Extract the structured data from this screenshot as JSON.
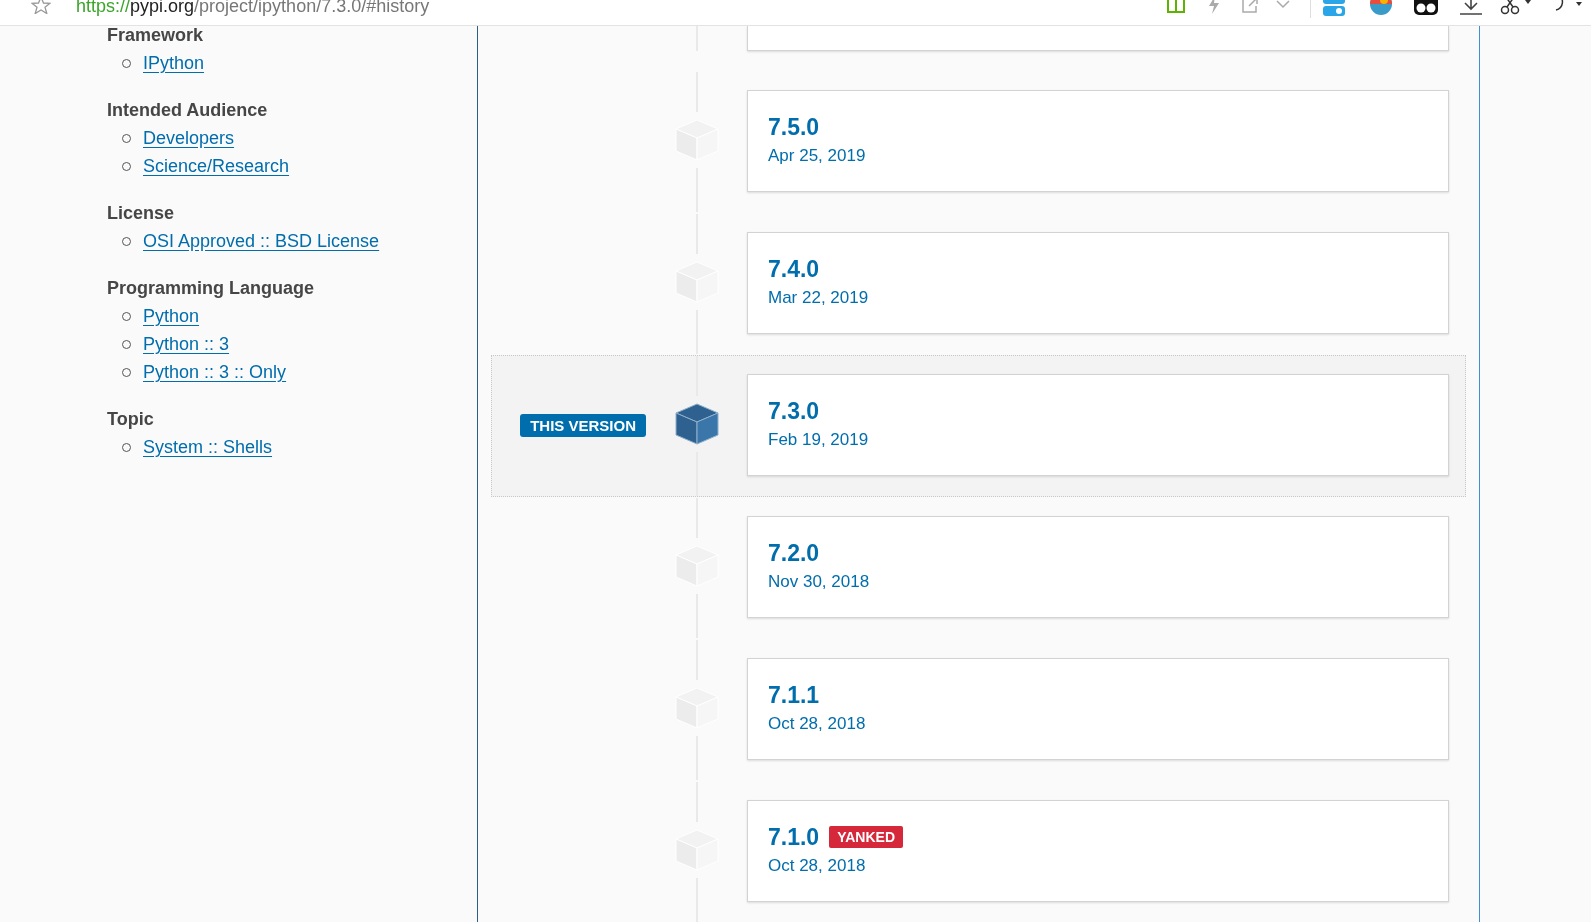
{
  "address_bar": {
    "scheme": "https://",
    "host": "pypi.org",
    "path": "/project/ipython/7.3.0/#history"
  },
  "sidebar": [
    {
      "heading": "Framework",
      "links": [
        "IPython"
      ]
    },
    {
      "heading": "Intended Audience",
      "links": [
        "Developers",
        "Science/Research"
      ]
    },
    {
      "heading": "License",
      "links": [
        "OSI Approved :: BSD License"
      ]
    },
    {
      "heading": "Programming Language",
      "links": [
        "Python",
        "Python :: 3",
        "Python :: 3 :: Only"
      ]
    },
    {
      "heading": "Topic",
      "links": [
        "System :: Shells"
      ]
    }
  ],
  "timeline": {
    "current_label": "THIS VERSION",
    "yanked_label": "YANKED",
    "releases": [
      {
        "version": "7.5.0",
        "date": "Apr 25, 2019",
        "selected": false,
        "yanked": false
      },
      {
        "version": "7.4.0",
        "date": "Mar 22, 2019",
        "selected": false,
        "yanked": false
      },
      {
        "version": "7.3.0",
        "date": "Feb 19, 2019",
        "selected": true,
        "yanked": false
      },
      {
        "version": "7.2.0",
        "date": "Nov 30, 2018",
        "selected": false,
        "yanked": false
      },
      {
        "version": "7.1.1",
        "date": "Oct 28, 2018",
        "selected": false,
        "yanked": false
      },
      {
        "version": "7.1.0",
        "date": "Oct 28, 2018",
        "selected": false,
        "yanked": true
      }
    ]
  }
}
